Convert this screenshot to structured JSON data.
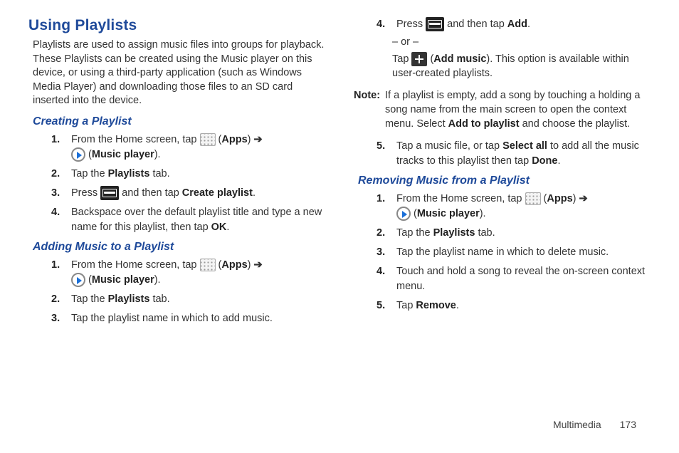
{
  "h1": "Using Playlists",
  "intro": "Playlists are used to assign music files into groups for playback. These Playlists can be created using the Music player on this device, or using a third-party application (such as Windows Media Player) and downloading those files to an SD card inserted into the device.",
  "creating": {
    "title": "Creating a Playlist",
    "s1a": "From the Home screen, tap ",
    "s1b": " (",
    "apps": "Apps",
    "s1c": ") ",
    "arrow": "➔",
    "s1d": " (",
    "music": "Music player",
    "s1e": ").",
    "s2a": "Tap the ",
    "playlists": "Playlists",
    "s2b": " tab.",
    "s3a": "Press ",
    "s3b": " and then tap ",
    "create": "Create playlist",
    "s3c": ".",
    "s4a": "Backspace over the default playlist title and type a new name for this playlist, then tap ",
    "ok": "OK",
    "s4b": "."
  },
  "adding": {
    "title": "Adding Music to a Playlist",
    "s3": "Tap the playlist name in which to add music."
  },
  "right": {
    "s4a": "Press ",
    "s4b": " and then tap ",
    "add": "Add",
    "s4c": ".",
    "or": "– or –",
    "tapa": "Tap ",
    "tapb": " (",
    "addmusic": "Add music",
    "tapc": "). This option is available within user-created playlists.",
    "noteLabel": "Note:",
    "note1": "If a playlist is empty, add a song by touching a holding a song name from the main screen to open the context menu. Select ",
    "addtoplaylist": "Add to playlist",
    "note2": " and choose the playlist.",
    "s5a": "Tap a music file, or tap ",
    "selectall": "Select all",
    "s5b": " to add all the music tracks to this playlist then tap ",
    "done": "Done",
    "s5c": "."
  },
  "removing": {
    "title": "Removing Music from a Playlist",
    "s3": "Tap the playlist name in which to delete music.",
    "s4": "Touch and hold a song to reveal the on-screen context menu.",
    "s5a": "Tap ",
    "remove": "Remove",
    "s5b": "."
  },
  "footer": {
    "section": "Multimedia",
    "page": "173"
  },
  "nums": {
    "n1": "1.",
    "n2": "2.",
    "n3": "3.",
    "n4": "4.",
    "n5": "5."
  }
}
